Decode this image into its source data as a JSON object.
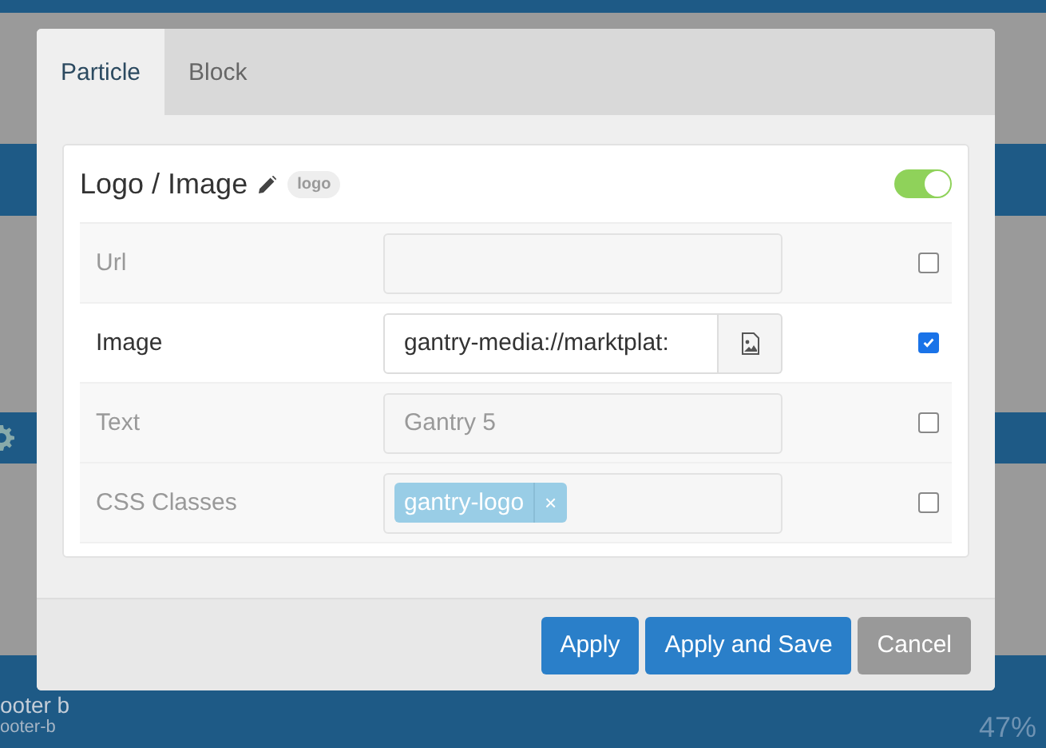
{
  "background": {
    "title": "ooter b",
    "subtitle": "ooter-b",
    "percent": "47%"
  },
  "tabs": [
    {
      "label": "Particle",
      "selected": true
    },
    {
      "label": "Block",
      "selected": false
    }
  ],
  "card": {
    "title": "Logo / Image",
    "badge": "logo",
    "enabled": true
  },
  "fields": [
    {
      "kind": "text",
      "label": "Url",
      "checked": false
    },
    {
      "kind": "image",
      "label": "Image",
      "value": "gantry-media://marktplat:",
      "checked": true
    },
    {
      "kind": "text",
      "label": "Text",
      "placeholder": "Gantry 5",
      "checked": false
    },
    {
      "kind": "tags",
      "label": "CSS Classes",
      "tags": [
        {
          "label": "gantry-logo",
          "remove": "×"
        }
      ],
      "checked": false
    }
  ],
  "buttons": [
    {
      "label": "Apply",
      "kind": "primary"
    },
    {
      "label": "Apply and Save",
      "kind": "primary"
    },
    {
      "label": "Cancel",
      "kind": "secondary"
    }
  ]
}
